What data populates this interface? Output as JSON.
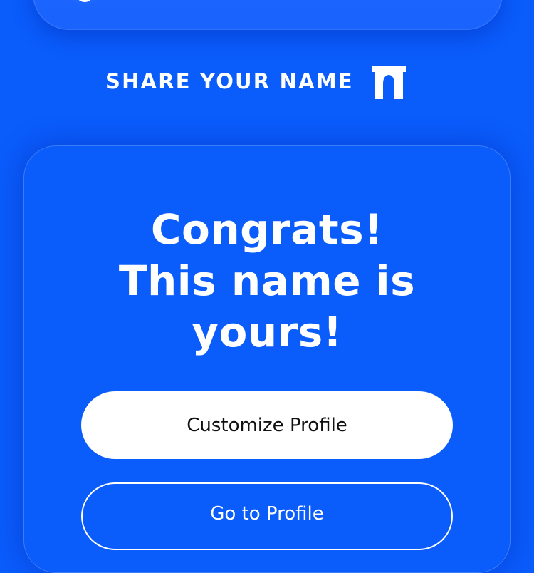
{
  "header": {
    "title": "SHARE YOUR NAME",
    "icon": "arch-icon"
  },
  "main": {
    "heading_lines": [
      "Congrats!",
      "This name is",
      "yours!"
    ],
    "primary_button_label": "Customize Profile",
    "secondary_button_label": "Go to Profile"
  },
  "colors": {
    "background": "#0a5cfb",
    "text": "#ffffff",
    "primary_button_bg": "#ffffff",
    "primary_button_text": "#111111"
  }
}
